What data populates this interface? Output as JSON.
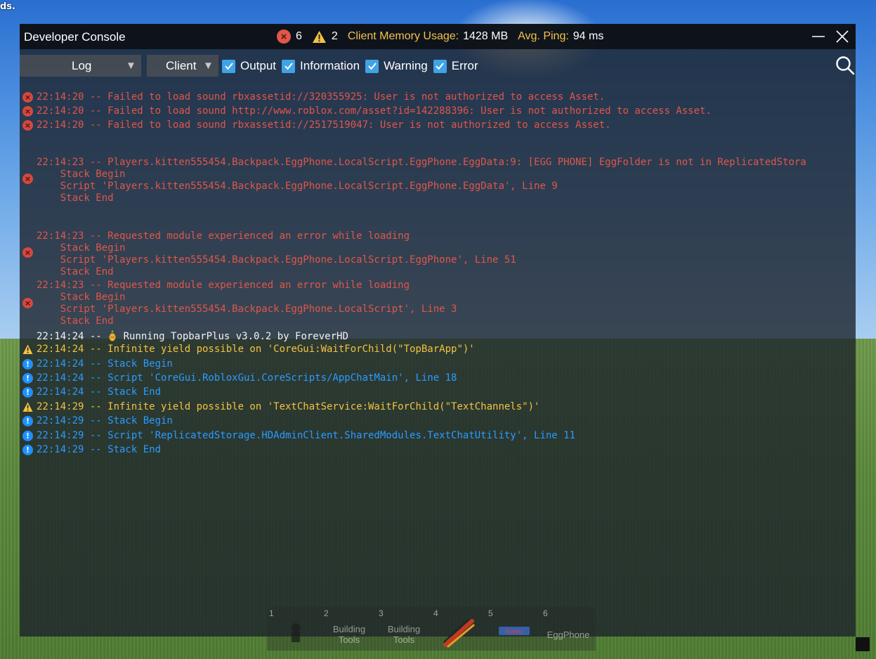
{
  "background": {
    "corner_text": "ds."
  },
  "console": {
    "title": "Developer Console",
    "stats": {
      "error_count": "6",
      "warning_count": "2",
      "memory_label": "Client Memory Usage:",
      "memory_value": "1428 MB",
      "ping_label": "Avg. Ping:",
      "ping_value": "94 ms"
    },
    "toolbar": {
      "log_dropdown": "Log",
      "client_dropdown": "Client",
      "filters": [
        "Output",
        "Information",
        "Warning",
        "Error"
      ]
    },
    "colors": {
      "error": "#e0564a",
      "warning": "#f3c33f",
      "info": "#2b9bff",
      "output": "#f2f2f2",
      "checkbox": "#3fa3e6"
    },
    "log": [
      {
        "type": "error",
        "lines": [
          "22:14:20 -- Failed to load sound rbxassetid://320355925: User is not authorized to access Asset."
        ]
      },
      {
        "type": "error",
        "lines": [
          "22:14:20 -- Failed to load sound http://www.roblox.com/asset?id=142288396: User is not authorized to access Asset."
        ]
      },
      {
        "type": "error",
        "lines": [
          "22:14:20 -- Failed to load sound rbxassetid://2517519047: User is not authorized to access Asset."
        ]
      },
      {
        "type": "error",
        "lines": [
          "22:14:23 -- Players.kitten555454.Backpack.EggPhone.LocalScript.EggPhone.EggData:9: [EGG PHONE] EggFolder is not in ReplicatedStora",
          "    Stack Begin",
          "    Script 'Players.kitten555454.Backpack.EggPhone.LocalScript.EggPhone.EggData', Line 9",
          "    Stack End"
        ]
      },
      {
        "type": "error",
        "lines": [
          "22:14:23 -- Requested module experienced an error while loading",
          "    Stack Begin",
          "    Script 'Players.kitten555454.Backpack.EggPhone.LocalScript.EggPhone', Line 51",
          "    Stack End"
        ]
      },
      {
        "type": "error",
        "lines": [
          "22:14:23 -- Requested module experienced an error while loading",
          "    Stack Begin",
          "    Script 'Players.kitten555454.Backpack.EggPhone.LocalScript', Line 3",
          "    Stack End"
        ]
      },
      {
        "type": "output",
        "prefix": "22:14:24 -- ",
        "suffix": " Running TopbarPlus v3.0.2 by ForeverHD",
        "icon": "pineapple-icon"
      },
      {
        "type": "warning",
        "lines": [
          "22:14:24 -- Infinite yield possible on 'CoreGui:WaitForChild(\"TopBarApp\")'"
        ]
      },
      {
        "type": "info",
        "lines": [
          "22:14:24 -- Stack Begin"
        ]
      },
      {
        "type": "info",
        "lines": [
          "22:14:24 -- Script 'CoreGui.RobloxGui.CoreScripts/AppChatMain', Line 18"
        ]
      },
      {
        "type": "info",
        "lines": [
          "22:14:24 -- Stack End"
        ]
      },
      {
        "type": "warning",
        "lines": [
          "22:14:29 -- Infinite yield possible on 'TextChatService:WaitForChild(\"TextChannels\")'"
        ]
      },
      {
        "type": "info",
        "lines": [
          "22:14:29 -- Stack Begin"
        ]
      },
      {
        "type": "info",
        "lines": [
          "22:14:29 -- Script 'ReplicatedStorage.HDAdminClient.SharedModules.TextChatUtility', Line 11"
        ]
      },
      {
        "type": "info",
        "lines": [
          "22:14:29 -- Stack End"
        ]
      }
    ]
  },
  "hotbar": [
    {
      "num": "1",
      "label": "",
      "art": "character-tool-icon"
    },
    {
      "num": "2",
      "label": "Building\nTools",
      "art": ""
    },
    {
      "num": "3",
      "label": "Building\nTools",
      "art": ""
    },
    {
      "num": "4",
      "label": "",
      "art": "stick-tool-icon"
    },
    {
      "num": "5",
      "label": "",
      "art": "roblox-tool-icon",
      "art_text": "Roblox"
    },
    {
      "num": "6",
      "label": "EggPhone",
      "art": ""
    }
  ]
}
